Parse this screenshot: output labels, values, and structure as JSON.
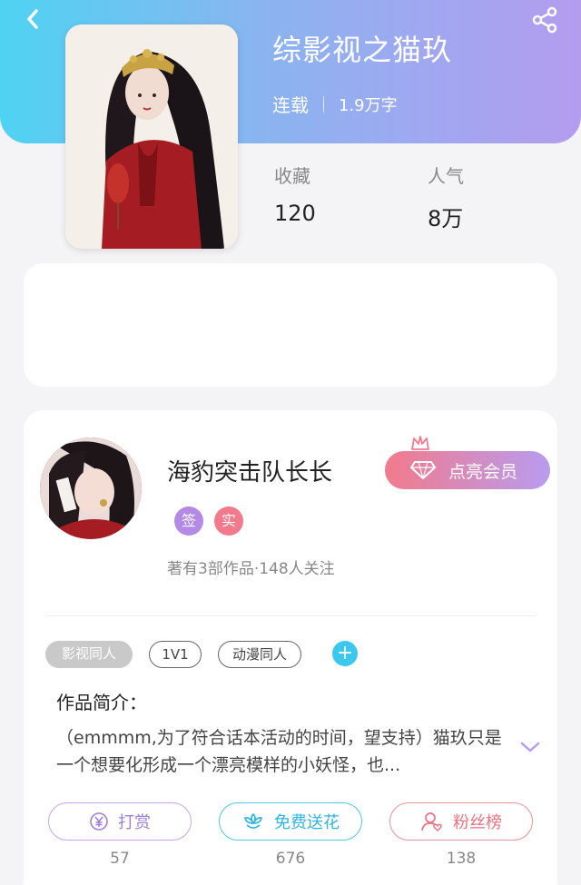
{
  "header": {
    "book_title": "综影视之猫玖",
    "status": "连载",
    "word_count": "1.9万字"
  },
  "stats": {
    "favorites": {
      "label": "收藏",
      "value": "120"
    },
    "popularity": {
      "label": "人气",
      "value": "8万"
    }
  },
  "author": {
    "name": "海豹突击队长长",
    "badges": [
      "签",
      "实"
    ],
    "meta": "著有3部作品·148人关注",
    "vip_label": "点亮会员"
  },
  "tags": [
    "影视同人",
    "1V1",
    "动漫同人"
  ],
  "intro": {
    "title": "作品简介：",
    "text": "（emmmm,为了符合话本活动的时间，望支持）猫玖只是一个想要化形成一个漂亮模样的小妖怪，也..."
  },
  "actions": [
    {
      "label": "打赏",
      "count": "57"
    },
    {
      "label": "免费送花",
      "count": "676"
    },
    {
      "label": "粉丝榜",
      "count": "138"
    }
  ],
  "icons": [
    "back-icon",
    "share-icon",
    "diamond-icon",
    "crown-icon",
    "plus-icon",
    "chevron-down-icon",
    "yuan-icon",
    "flower-icon",
    "fans-icon"
  ],
  "colors": {
    "cyan": "#3ac8ee",
    "purple": "#b49cef",
    "pink": "#f27a8c"
  }
}
